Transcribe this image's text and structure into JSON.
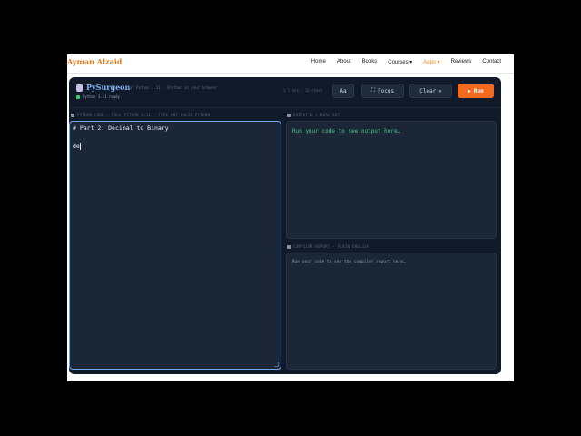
{
  "site": {
    "logo": "Ayman Alzaid",
    "nav": [
      {
        "label": "Home"
      },
      {
        "label": "About"
      },
      {
        "label": "Books"
      },
      {
        "label": "Courses ▾"
      },
      {
        "label": "Apps ▾"
      },
      {
        "label": "Reviews"
      },
      {
        "label": "Contact"
      }
    ],
    "active_nav": "Apps ▾"
  },
  "app": {
    "brand_name": "PySurgeon",
    "brand_sub": "Real Python 3.11 · CPython in your browser",
    "status": "Python 3.11 ready",
    "stats": "3 lines · 32 chars",
    "buttons": {
      "font": "Aa",
      "focus": "Focus",
      "focus_icon": "⛶",
      "clear": "Clear",
      "clear_icon": "✕",
      "run": "Run",
      "run_icon": "▶"
    },
    "editor_label": "PYTHON CODE · FULL PYTHON 3.11 · TYPE ANY VALID PYTHON",
    "code_line1": "# Part 2: Decimal to Binary",
    "code_line2": "de",
    "output_label": "OUTPUT & ⚡ REAL EXT",
    "output_placeholder": "Run your code to see output here…",
    "report_label": "COMPILER REPORT · PLAIN ENGLISH",
    "report_placeholder": "Run your code to see the compiler report here…"
  },
  "colors": {
    "accent": "#f26b1f",
    "brand": "#7fb4f5",
    "logo": "#e07b22",
    "ok": "#3ecf6a"
  }
}
